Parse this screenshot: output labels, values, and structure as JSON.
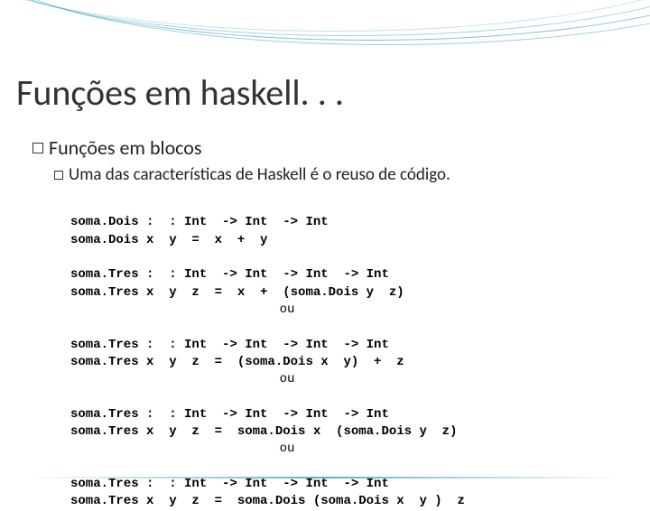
{
  "title": "Funções em haskell. . .",
  "bullets": {
    "level1": "Funções  em blocos",
    "level2": "Uma das características de Haskell é o reuso de código."
  },
  "code": {
    "l1": "soma.Dois :  : Int  -> Int  -> Int",
    "l2": "soma.Dois x  y  =  x  +  y",
    "l3": "soma.Tres :  : Int  -> Int  -> Int  -> Int",
    "l4": "soma.Tres x  y  z  =  x  +  (soma.Dois y  z)",
    "ou": "ou",
    "l5": "soma.Tres :  : Int  -> Int  -> Int  -> Int",
    "l6": "soma.Tres x  y  z  =  (soma.Dois x  y)  +  z",
    "l7": "soma.Tres :  : Int  -> Int  -> Int  -> Int",
    "l8": "soma.Tres x  y  z  =  soma.Dois x  (soma.Dois y  z)",
    "l9": "soma.Tres :  : Int  -> Int  -> Int  -> Int",
    "l10": "soma.Tres x  y  z  =  soma.Dois (soma.Dois x  y )  z"
  }
}
